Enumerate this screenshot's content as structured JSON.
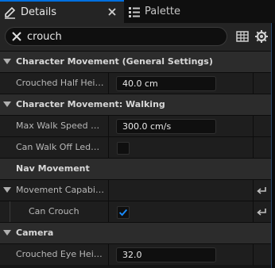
{
  "tabs": [
    {
      "label": "Details"
    },
    {
      "label": "Palette"
    }
  ],
  "search": {
    "value": "crouch"
  },
  "rows": [
    {
      "kind": "category",
      "label": "Character Movement (General Settings)"
    },
    {
      "kind": "property",
      "label": "Crouched Half Height",
      "value": "40.0 cm"
    },
    {
      "kind": "category",
      "label": "Character Movement: Walking"
    },
    {
      "kind": "property",
      "label": "Max Walk Speed Cro...",
      "value": "300.0 cm/s"
    },
    {
      "kind": "property",
      "label": "Can Walk Off Ledges...",
      "checked": false
    },
    {
      "kind": "category",
      "label": "Nav Movement"
    },
    {
      "kind": "group",
      "label": "Movement Capabiliti..."
    },
    {
      "kind": "property",
      "label": "Can Crouch",
      "checked": true
    },
    {
      "kind": "category",
      "label": "Camera"
    },
    {
      "kind": "property",
      "label": "Crouched Eye Height",
      "value": "32.0"
    }
  ],
  "colors": {
    "accent": "#0070e0",
    "check": "#1a8cff"
  }
}
